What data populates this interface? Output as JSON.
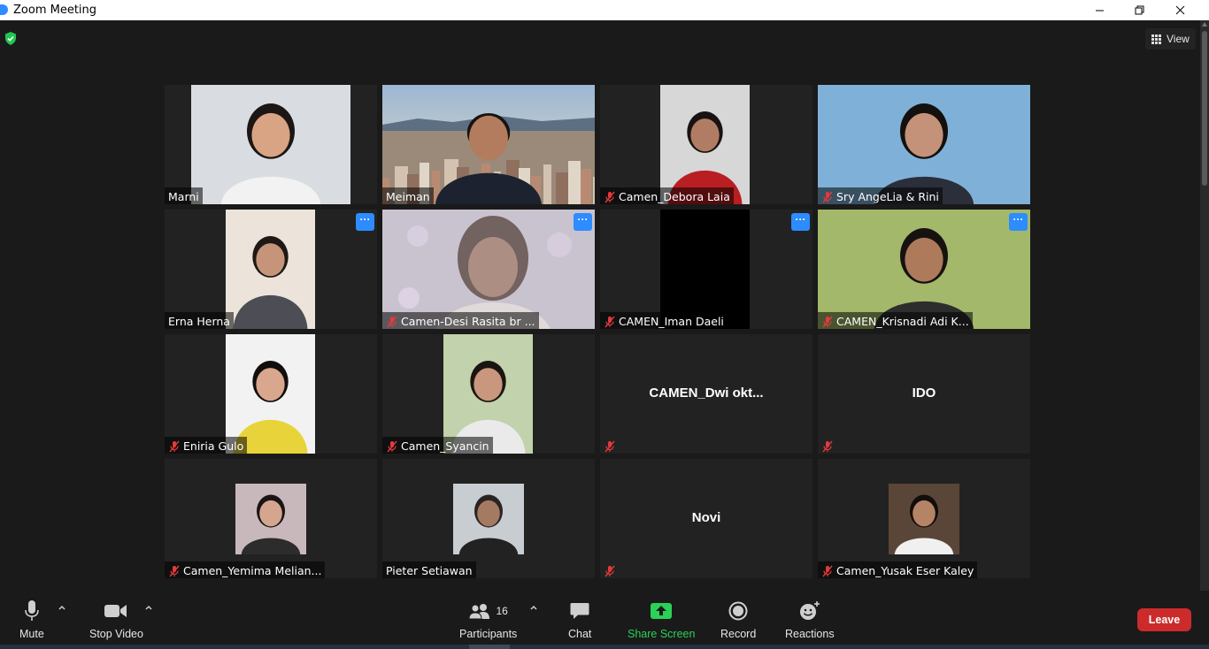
{
  "window": {
    "title": "Zoom Meeting"
  },
  "view_button": {
    "label": "View"
  },
  "participants_grid": [
    {
      "name": "Marni",
      "muted": false,
      "more": false,
      "video": "person",
      "shirt": "#f2f2f2",
      "bg": "#d9dde2",
      "hair": "#1c1614",
      "skin": "#d8a483"
    },
    {
      "name": "Meiman",
      "muted": false,
      "more": false,
      "video": "city",
      "shirt": "#1c2230",
      "bg": "#8aa6c0",
      "hair": "#161412",
      "skin": "#b37c5e",
      "active": true
    },
    {
      "name": "Camen_Debora Laia",
      "muted": true,
      "more": false,
      "video": "person",
      "shirt": "#b81e22",
      "bg": "#d7d7d7",
      "hair": "#1a1212",
      "skin": "#b07d64"
    },
    {
      "name": "Sry AngeLia & Rini",
      "muted": true,
      "more": false,
      "video": "person",
      "shirt": "#2a2f3a",
      "bg": "#7fb1d8",
      "hair": "#14100e",
      "skin": "#c49179"
    },
    {
      "name": "Erna Herna",
      "muted": false,
      "more": true,
      "video": "person",
      "shirt": "#4d4d55",
      "bg": "#ece4da",
      "hair": "#1e1816",
      "skin": "#c69579"
    },
    {
      "name": "Camen-Desi Rasita br ...",
      "muted": true,
      "more": true,
      "video": "blur",
      "shirt": "#e0dada",
      "bg": "#c9c3cf",
      "hair": "#5c4a44",
      "skin": "#b49386"
    },
    {
      "name": "CAMEN_Iman Daeli",
      "muted": true,
      "more": true,
      "video": "black",
      "shirt": "#000000",
      "bg": "#000000",
      "hair": "#000000",
      "skin": "#000000"
    },
    {
      "name": "CAMEN_Krisnadi Adi K...",
      "muted": true,
      "more": true,
      "video": "person",
      "shirt": "#2d2d2d",
      "bg": "#a3b86a",
      "hair": "#16120f",
      "skin": "#ad7a5c"
    },
    {
      "name": "Eniria Gulo",
      "muted": true,
      "more": false,
      "video": "person",
      "shirt": "#e9d33a",
      "bg": "#f2f2f2",
      "hair": "#120e0c",
      "skin": "#d9a78d"
    },
    {
      "name": "Camen_Syancin",
      "muted": true,
      "more": false,
      "video": "person",
      "shirt": "#eaeaea",
      "bg": "#c2d2ac",
      "hair": "#1b1512",
      "skin": "#c9967e"
    },
    {
      "name": "",
      "center_name": "CAMEN_Dwi  okt...",
      "muted": true,
      "more": false,
      "video": "none"
    },
    {
      "name": "",
      "center_name": "IDO",
      "muted": true,
      "more": false,
      "video": "none"
    },
    {
      "name": "Camen_Yemima Melian...",
      "muted": true,
      "more": false,
      "video": "avatar",
      "shirt": "#2c2c2c",
      "bg": "#c8b8bc",
      "hair": "#1a1414",
      "skin": "#d4a68e"
    },
    {
      "name": "Pieter Setiawan",
      "muted": false,
      "more": false,
      "video": "avatar",
      "shirt": "#222222",
      "bg": "#c8cdd2",
      "hair": "#2a2422",
      "skin": "#a57a62"
    },
    {
      "name": "",
      "center_name": "Novi",
      "muted": true,
      "more": false,
      "video": "none"
    },
    {
      "name": "Camen_Yusak Eser Kaley",
      "muted": true,
      "more": false,
      "video": "avatar",
      "shirt": "#f0f0f0",
      "bg": "#5a4638",
      "hair": "#120e0c",
      "skin": "#b58466"
    }
  ],
  "toolbar": {
    "mute_label": "Mute",
    "stop_video_label": "Stop Video",
    "participants_label": "Participants",
    "participants_count": "16",
    "chat_label": "Chat",
    "share_screen_label": "Share Screen",
    "record_label": "Record",
    "reactions_label": "Reactions",
    "leave_label": "Leave"
  },
  "colors": {
    "accent": "#2D8CFF",
    "share_green": "#2bd157",
    "leave_red": "#cc2b2b",
    "active_speaker": "#c9e265"
  },
  "icons": [
    "zoom-icon",
    "minimize-icon",
    "restore-icon",
    "close-icon",
    "shield-check-icon",
    "grid-icon",
    "mic-icon",
    "video-camera-icon",
    "participants-icon",
    "chat-bubble-icon",
    "share-arrow-icon",
    "record-icon",
    "smiley-add-icon",
    "muted-mic-icon",
    "more-dots-icon"
  ]
}
